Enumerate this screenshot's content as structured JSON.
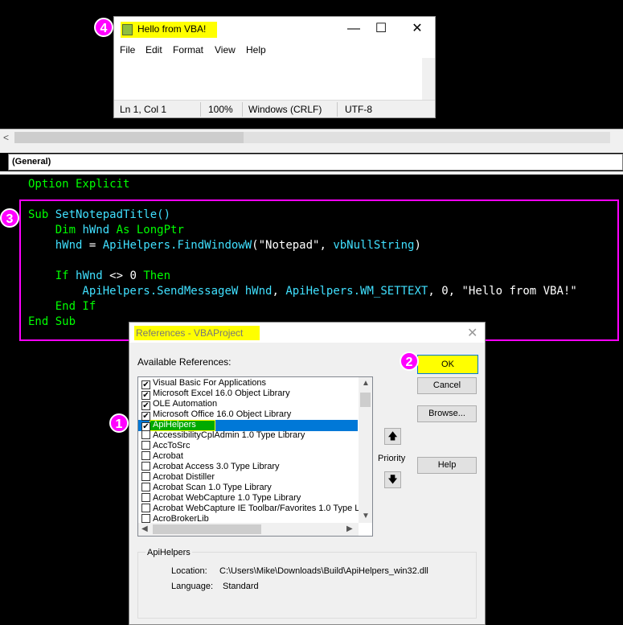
{
  "notepad": {
    "title": "Hello from VBA!",
    "menu": [
      "File",
      "Edit",
      "Format",
      "View",
      "Help"
    ],
    "status": {
      "position": "Ln 1, Col 1",
      "zoom": "100%",
      "line_ending": "Windows (CRLF)",
      "encoding": "UTF-8"
    }
  },
  "vbe": {
    "object_combo": "(General)",
    "code": {
      "option_kw": "Option Explicit",
      "l1_kw": "Sub ",
      "l1_name": "SetNotepadTitle()",
      "l2_kw1": "    Dim ",
      "l2_id": "hWnd",
      "l2_kw2": " As ",
      "l2_type": "LongPtr",
      "l3_id": "    hWnd",
      "l3_eq": " = ",
      "l3_mod": "ApiHelpers.",
      "l3_fn": "FindWindowW",
      "l3_args": "(\"Notepad\", ",
      "l3_const": "vbNullString",
      "l3_end": ")",
      "l5_kw1": "    If ",
      "l5_id": "hWnd",
      "l5_op": " <> 0 ",
      "l5_kw2": "Then",
      "l6_mod": "        ApiHelpers.",
      "l6_fn": "SendMessageW",
      "l6_sp": " ",
      "l6_id": "hWnd",
      "l6_c1": ", ",
      "l6_mod2": "ApiHelpers.",
      "l6_const": "WM_SETTEXT",
      "l6_rest": ", 0, \"Hello from VBA!\"",
      "l7_kw": "    End If",
      "l8_kw": "End Sub"
    }
  },
  "references": {
    "title": "References - VBAProject",
    "available_label": "Available References:",
    "items": [
      {
        "label": "Visual Basic For Applications",
        "checked": "✔"
      },
      {
        "label": "Microsoft Excel 16.0 Object Library",
        "checked": "✔"
      },
      {
        "label": "OLE Automation",
        "checked": "✔"
      },
      {
        "label": "Microsoft Office 16.0 Object Library",
        "checked": "✔"
      },
      {
        "label": "ApiHelpers",
        "checked": "✔"
      },
      {
        "label": "AccessibilityCplAdmin 1.0 Type Library",
        "checked": ""
      },
      {
        "label": "AccToSrc",
        "checked": ""
      },
      {
        "label": "Acrobat",
        "checked": ""
      },
      {
        "label": "Acrobat Access 3.0 Type Library",
        "checked": ""
      },
      {
        "label": "Acrobat Distiller",
        "checked": ""
      },
      {
        "label": "Acrobat Scan 1.0 Type Library",
        "checked": ""
      },
      {
        "label": "Acrobat WebCapture 1.0 Type Library",
        "checked": ""
      },
      {
        "label": "Acrobat WebCapture IE Toolbar/Favorites 1.0 Type L",
        "checked": ""
      },
      {
        "label": "AcroBrokerLib",
        "checked": ""
      }
    ],
    "buttons": {
      "ok": "OK",
      "cancel": "Cancel",
      "browse": "Browse...",
      "help": "Help"
    },
    "priority_label": "Priority",
    "group_title": "ApiHelpers",
    "location_label": "Location:",
    "location_value": "C:\\Users\\Mike\\Downloads\\Build\\ApiHelpers_win32.dll",
    "language_label": "Language:",
    "language_value": "Standard"
  },
  "badges": [
    "1",
    "2",
    "3",
    "4"
  ],
  "colors": {
    "annotation": "#ff00ff",
    "highlight": "#ffff00",
    "code_green": "#00ff00",
    "code_cyan": "#40e0ff"
  }
}
